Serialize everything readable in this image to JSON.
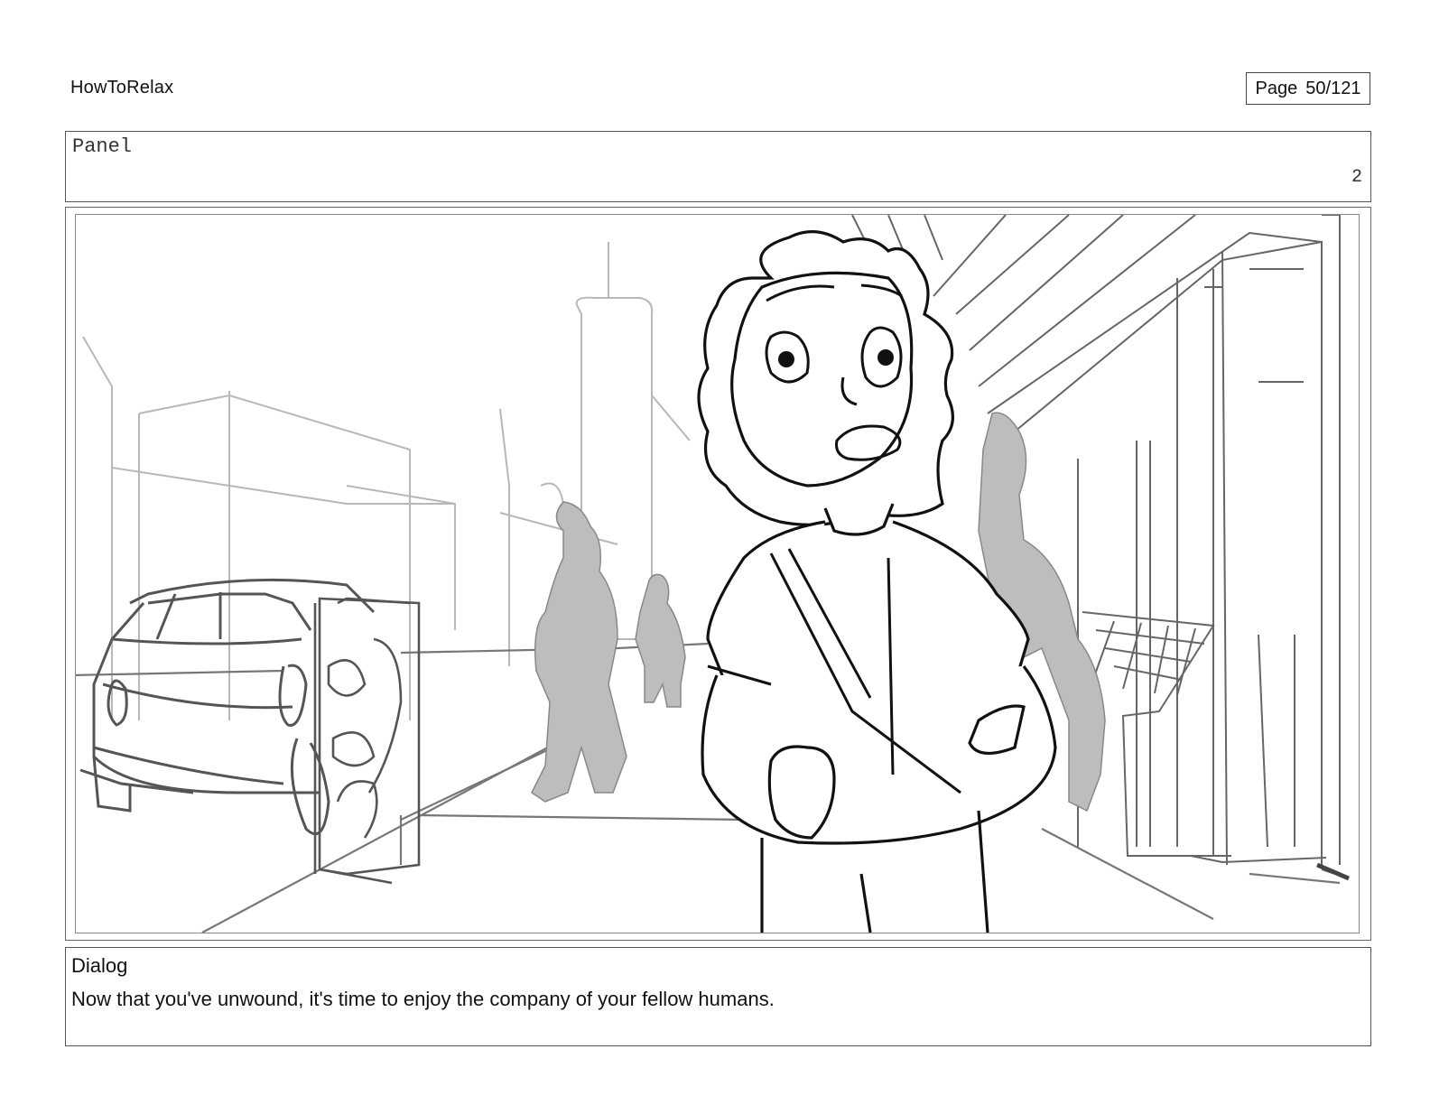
{
  "header": {
    "title": "HowToRelax",
    "page_label": "Page",
    "page_value": "50/121"
  },
  "panel": {
    "label": "Panel",
    "number": "2"
  },
  "frame": {
    "description_icon": "storyboard-sketch"
  },
  "dialog": {
    "label": "Dialog",
    "text": "Now that you've unwound, it's time to enjoy the company of your fellow humans."
  }
}
